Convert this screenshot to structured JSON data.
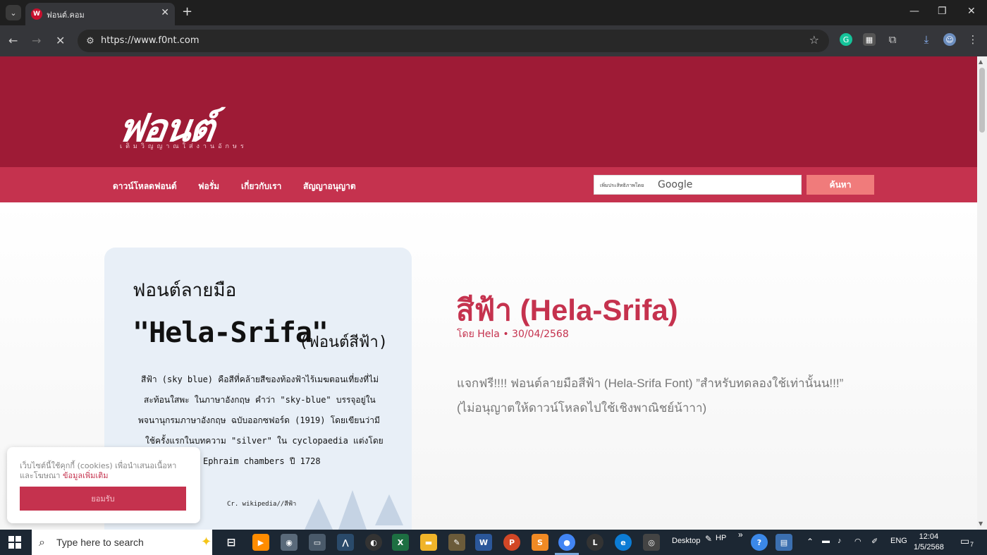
{
  "browser": {
    "tab_title": "ฟอนต์.คอม",
    "tab_favicon": "W",
    "new_tab": "+",
    "close": "✕",
    "url": "https://www.f0nt.com",
    "back": "←",
    "forward": "→",
    "reload": "✕",
    "star": "☆"
  },
  "site": {
    "logo": "ฟอนต์",
    "tagline": "เติมวิญญาณใส่งานอักษร",
    "nav": [
      "ดาวน์โหลดฟอนต์",
      "ฟอรั่ม",
      "เกี่ยวกับเรา",
      "สัญญาอนุญาต"
    ],
    "search": {
      "enhanced": "เพิ่มประสิทธิภาพโดย",
      "brand": "Google",
      "button": "ค้นหา"
    }
  },
  "card": {
    "line1": "ฟอนต์ลายมือ",
    "line2": "\"Hela-Srifa\"",
    "line2b": "(ฟอนต์สีฟ้า)",
    "para": [
      "สีฟ้า (sky blue) คือสีที่คล้ายสีของท้องฟ้าไร้เมฆตอนเที่ยงที่ไม่",
      "สะท้อนใสพะ ในภาษาอังกฤษ คำว่า \"sky-blue\" บรรจุอยู่ใน",
      "พจนานุกรมภาษาอังกฤษ ฉบับออกซฟอร์ด (1919) โดยเขียนว่ามี",
      "ใช้ครั้งแรกในบทความ \"silver\" ใน cyclopaedia แต่งโดย",
      "Ephraim chambers ปี 1728"
    ],
    "credit": "Cr. wikipedia//สีฟ้า"
  },
  "post": {
    "title": "สีฟ้า (Hela-Srifa)",
    "meta": "โดย Hela • 30/04/2568",
    "body": "แจกฟรี!!!! ฟอนต์ลายมือสีฟ้า (Hela-Srifa Font) ”สำหรับทดลองใช้เท่านั้นน!!!” (ไม่อนุญาตให้ดาวน์โหลดไปใช้เชิงพาณิชย์น้าาา)"
  },
  "cookie": {
    "text": "เว็บไซต์นี้ใช้คุกกี้ (cookies) เพื่อนำเสนอเนื้อหาและโฆษณา",
    "link": "ข้อมูลเพิ่มเติม",
    "button": "ยอมรับ"
  },
  "taskbar": {
    "search_placeholder": "Type here to search",
    "desktop": "Desktop",
    "hp": "HP",
    "lang": "ENG",
    "time": "12:04",
    "date": "1/5/2568",
    "notif": "7"
  },
  "colors": {
    "header": "#9e1b36",
    "nav": "#c5324e",
    "accent": "#c5324e",
    "search_button": "#f07b7b"
  }
}
